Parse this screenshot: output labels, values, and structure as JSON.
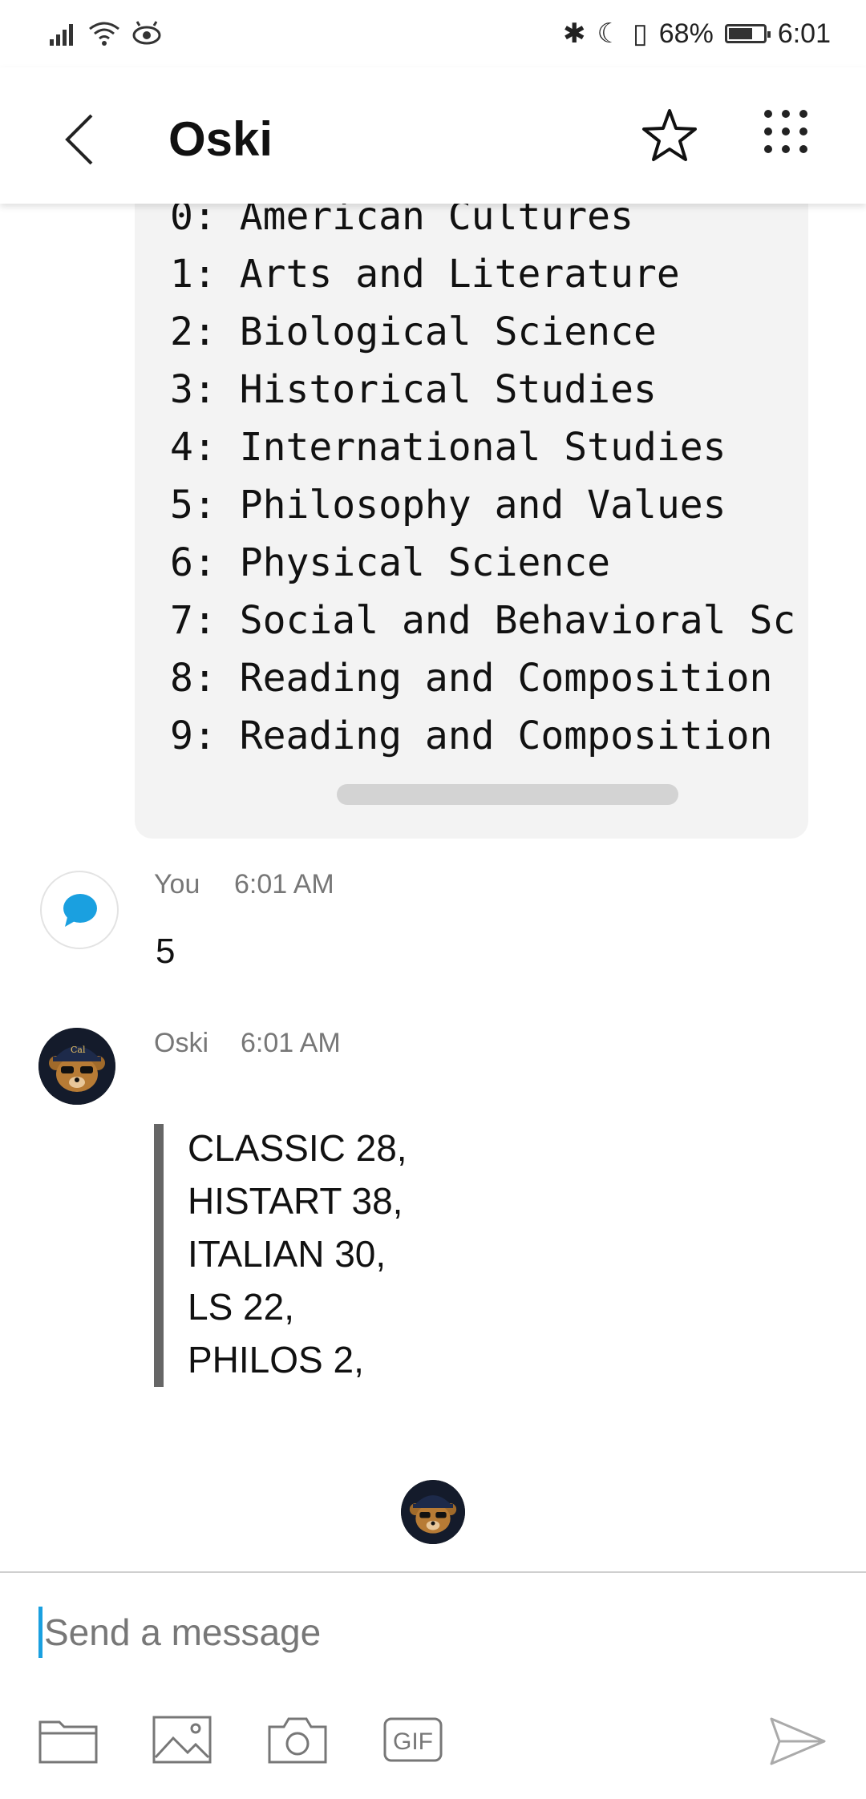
{
  "status_bar": {
    "battery_percent": "68%",
    "time": "6:01",
    "battery_level": 0.68
  },
  "header": {
    "title": "Oski"
  },
  "code_block": {
    "lines": [
      "0: American Cultures",
      "1: Arts and Literature",
      "2: Biological Science",
      "3: Historical Studies",
      "4: International Studies",
      "5: Philosophy and Values",
      "6: Physical Science",
      "7: Social and Behavioral Sc",
      "8: Reading and Composition",
      "9: Reading and Composition"
    ]
  },
  "messages": [
    {
      "sender": "You",
      "time": "6:01 AM",
      "text": "5"
    },
    {
      "sender": "Oski",
      "time": "6:01 AM",
      "quote_lines": [
        "CLASSIC 28,",
        "HISTART 38,",
        "ITALIAN 30,",
        "LS 22,",
        "PHILOS 2,"
      ]
    }
  ],
  "composer": {
    "placeholder": "Send a message",
    "tools": [
      "folder-icon",
      "image-icon",
      "camera-icon",
      "gif-icon"
    ],
    "gif_label": "GIF",
    "send_icon": "send-icon"
  },
  "colors": {
    "accent": "#1aa0e0",
    "quote_bar": "#666666",
    "code_bg": "#f3f3f3"
  }
}
